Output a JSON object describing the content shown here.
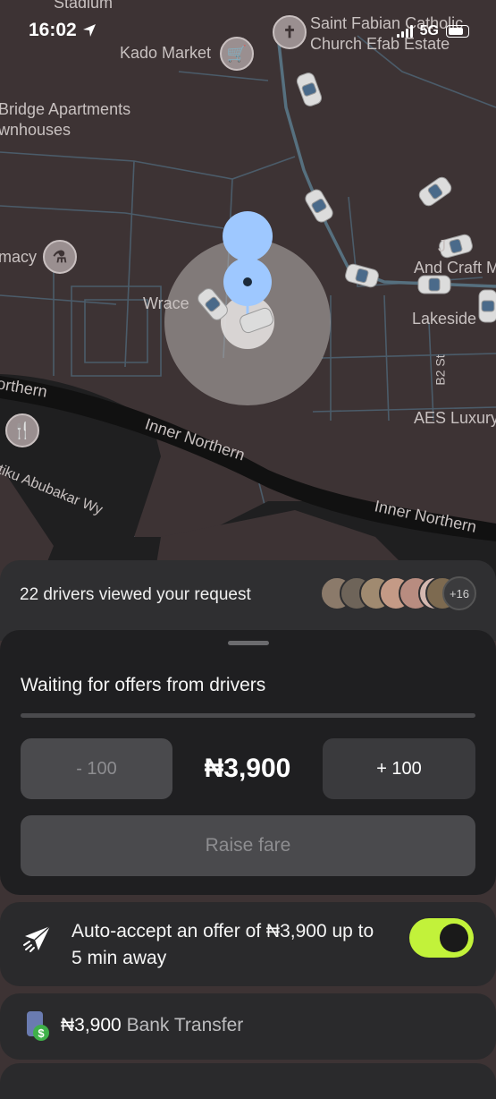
{
  "status_bar": {
    "time": "16:02",
    "network": "5G"
  },
  "map": {
    "labels": {
      "top_stadium": "Stadium",
      "kado_market": "Kado Market",
      "saint_fabian": "Saint Fabian Catholic Church Efab Estate",
      "saint_fabian_line1": "Saint Fabian Catholic",
      "saint_fabian_line2": "Church Efab Estate",
      "bridge_line1": "Bridge Apartments",
      "bridge_line2": "wnhouses",
      "pharmacy": "macy",
      "wrace": "Wrace",
      "arts_line1": "J",
      "arts_line2": "And Craft M",
      "lakeside": "Lakeside",
      "b2": "B2 St",
      "aes": "AES Luxury",
      "northern_left": "orthern",
      "inner_northern_1": "Inner Northern",
      "inner_northern_2": "Inner Northern",
      "atiku": "tiku Abubakar Wy"
    }
  },
  "viewed": {
    "text": "22 drivers viewed your request",
    "more_count": "+16"
  },
  "offers": {
    "waiting_text": "Waiting for offers from drivers",
    "decrease_label": "- 100",
    "fare": "₦3,900",
    "increase_label": "+ 100",
    "raise_label": "Raise fare",
    "progress": 0
  },
  "auto_accept": {
    "text": "Auto-accept an offer of ₦3,900 up to 5 min away",
    "enabled": true
  },
  "payment": {
    "amount": "₦3,900",
    "method": "Bank Transfer"
  },
  "colors": {
    "accent_toggle": "#c2f23a",
    "map_background": "#3d3334",
    "sheet_background": "#1f1f21",
    "pickup_pin": "#9ec8ff"
  }
}
